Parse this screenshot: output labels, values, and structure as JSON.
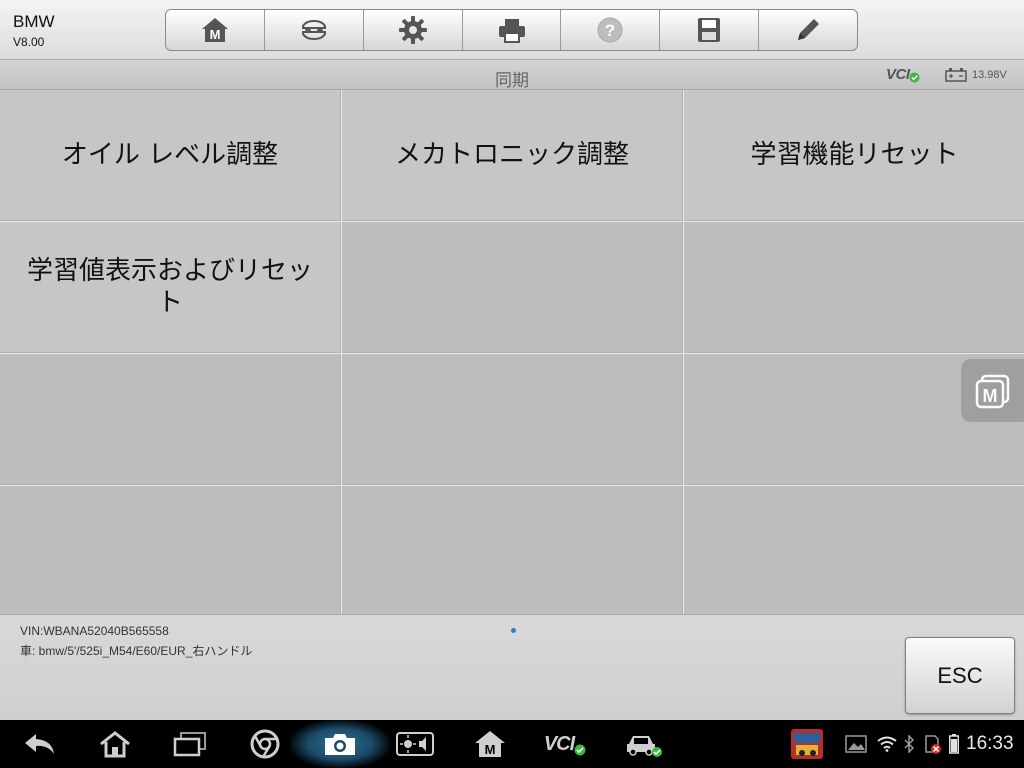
{
  "app": {
    "brand": "BMW",
    "version": "V8.00"
  },
  "toolbar": {
    "buttons": [
      {
        "icon": "home-m-icon"
      },
      {
        "icon": "vehicle-swap-icon"
      },
      {
        "icon": "gear-icon"
      },
      {
        "icon": "printer-icon"
      },
      {
        "icon": "help-icon"
      },
      {
        "icon": "save-icon"
      },
      {
        "icon": "pencil-icon"
      }
    ]
  },
  "titlebar": {
    "title": "同期",
    "vci_label": "VCI",
    "voltage": "13.98V"
  },
  "grid": {
    "cells": [
      "オイル レベル調整",
      "メカトロニック調整",
      "学習機能リセット",
      "学習値表示およびリセット",
      "",
      "",
      "",
      "",
      "",
      "",
      "",
      ""
    ]
  },
  "footer": {
    "vin": "VIN:WBANA52040B565558",
    "car": "車: bmw/5'/525i_M54/E60/EUR_右ハンドル",
    "esc_label": "ESC"
  },
  "navbar": {
    "vci_label": "VCI",
    "time": "16:33"
  },
  "colors": {
    "accent_green": "#3cb83c",
    "page_dot": "#2a7fd0",
    "nav_glow": "#2b6d93"
  }
}
